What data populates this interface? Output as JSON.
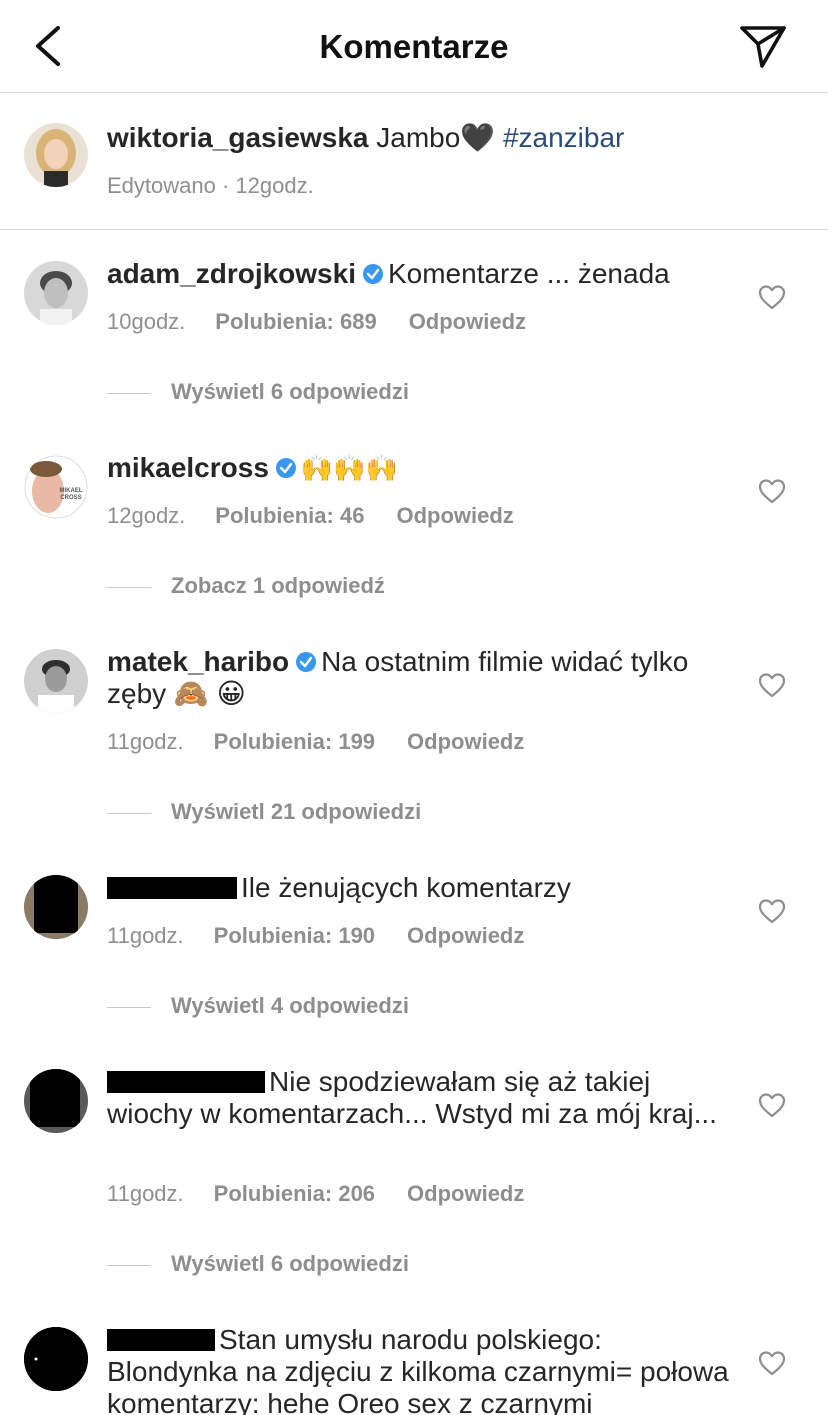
{
  "header": {
    "title": "Komentarze",
    "back_icon": "chevron-left-icon",
    "send_icon": "paper-plane-icon"
  },
  "caption": {
    "username": "wiktoria_gasiewska",
    "text": "Jambo",
    "emoji": "🖤",
    "hashtag": "#zanzibar",
    "edited": "Edytowano",
    "separator": " · ",
    "time": "12godz."
  },
  "comments": [
    {
      "username": "adam_zdrojkowski",
      "verified": true,
      "text": "Komentarze ... żenada",
      "time": "10godz.",
      "likes": "Polubienia: 689",
      "reply": "Odpowiedz",
      "replies_label": "Wyświetl 6 odpowiedzi"
    },
    {
      "username": "mikaelcross",
      "verified": true,
      "text": "🙌🙌🙌",
      "time": "12godz.",
      "likes": "Polubienia: 46",
      "reply": "Odpowiedz",
      "replies_label": "Zobacz 1 odpowiedź",
      "avatar_text": "MIKAEL CROSS"
    },
    {
      "username": "matek_haribo",
      "verified": true,
      "text": "Na ostatnim filmie widać tylko zęby 🙈 😀",
      "time": "11godz.",
      "likes": "Polubienia: 199",
      "reply": "Odpowiedz",
      "replies_label": "Wyświetl 21 odpowiedzi"
    },
    {
      "username": "",
      "redacted": true,
      "text": "Ile żenujących komentarzy",
      "time": "11godz.",
      "likes": "Polubienia: 190",
      "reply": "Odpowiedz",
      "replies_label": "Wyświetl 4 odpowiedzi"
    },
    {
      "username": "",
      "redacted": true,
      "text": "Nie spodziewałam się aż takiej wiochy w komentarzach... Wstyd mi za mój kraj...",
      "time": "11godz.",
      "likes": "Polubienia: 206",
      "reply": "Odpowiedz",
      "replies_label": "Wyświetl 6 odpowiedzi"
    },
    {
      "username": "",
      "redacted": true,
      "text": "Stan umysłu narodu polskiego: Blondynka na zdjęciu z kilkoma czarnymi= połowa komentarzy: hehe Oreo sex z czarnymi"
    }
  ],
  "colors": {
    "verified": "#3897f0",
    "hashtag": "#2b4b78",
    "muted": "#8e8e8e",
    "divider": "#dbdbdb"
  }
}
